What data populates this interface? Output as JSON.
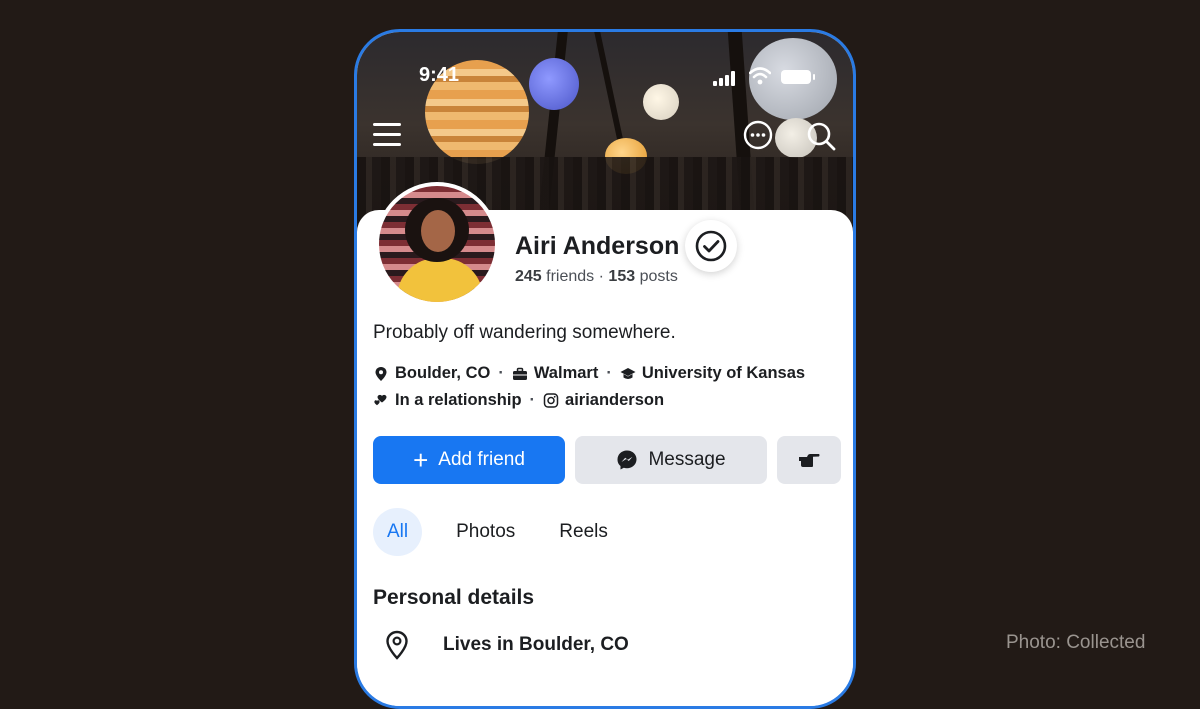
{
  "status_bar": {
    "time": "9:41"
  },
  "profile": {
    "name": "Airi Anderson",
    "friends_count": "245",
    "friends_label": "friends",
    "posts_count": "153",
    "posts_label": "posts",
    "separator": "·",
    "bio": "Probably off wandering somewhere.",
    "details": {
      "location": "Boulder, CO",
      "work": "Walmart",
      "education": "University of Kansas",
      "relationship": "In a relationship",
      "instagram": "airianderson"
    }
  },
  "actions": {
    "add_friend": "Add friend",
    "add_icon": "+",
    "message": "Message"
  },
  "tabs": [
    "All",
    "Photos",
    "Reels"
  ],
  "personal_details": {
    "title": "Personal details",
    "lives_in": "Lives in Boulder, CO"
  },
  "credit": "Photo: Collected",
  "colors": {
    "accent": "#1877f2",
    "frame": "#2a7be4",
    "background": "#221a16"
  },
  "icons": {
    "menu": "hamburger-icon",
    "more": "more-icon",
    "search": "search-icon",
    "verified": "verified-check-icon",
    "location": "location-pin-icon",
    "work": "briefcase-icon",
    "education": "graduation-cap-icon",
    "relationship": "hearts-icon",
    "instagram": "instagram-icon",
    "messenger": "messenger-icon",
    "poke": "poke-hand-icon"
  }
}
